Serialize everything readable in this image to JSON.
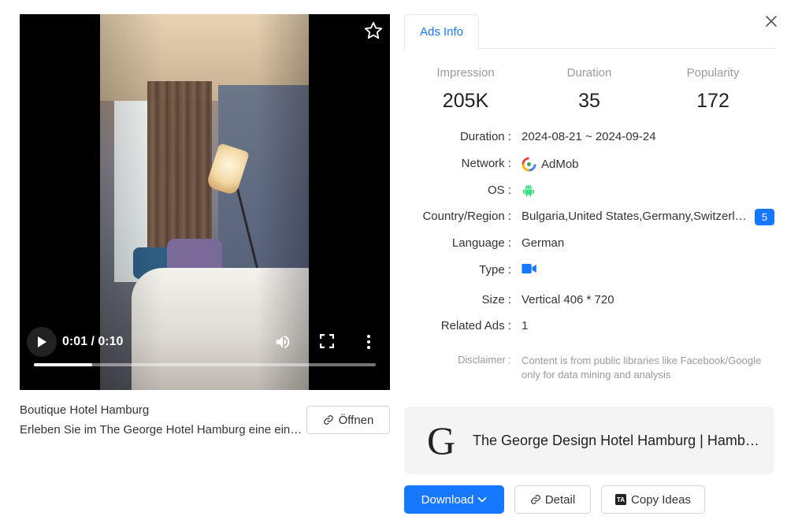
{
  "video": {
    "time": "0:01 / 0:10",
    "progress_fraction": 0.17
  },
  "ad": {
    "title": "Boutique Hotel Hamburg",
    "description": "Erleben Sie im The George Hotel Hamburg eine einzigartige Atmosphäre",
    "open_label": "Öffnen"
  },
  "tabs": [
    {
      "label": "Ads Info",
      "active": true
    }
  ],
  "stats": {
    "impression": {
      "label": "Impression",
      "value": "205K"
    },
    "duration": {
      "label": "Duration",
      "value": "35"
    },
    "popularity": {
      "label": "Popularity",
      "value": "172"
    }
  },
  "details": {
    "duration": {
      "label": "Duration :",
      "value": "2024-08-21 ~ 2024-09-24"
    },
    "network": {
      "label": "Network :",
      "value": "AdMob",
      "icon": "admob-icon"
    },
    "os": {
      "label": "OS :",
      "icon": "android-icon"
    },
    "country": {
      "label": "Country/Region :",
      "value": "Bulgaria,United States,Germany,Switzerland,Austria",
      "count": "5"
    },
    "language": {
      "label": "Language :",
      "value": "German"
    },
    "type": {
      "label": "Type :",
      "icon": "video-camera-icon"
    },
    "size": {
      "label": "Size :",
      "value": "Vertical 406 * 720"
    },
    "related": {
      "label": "Related Ads :",
      "value": "1"
    },
    "disclaimer": {
      "label": "Disclaimer :",
      "value": "Content is from public libraries like Facebook/Google only for data mining and analysis"
    }
  },
  "advertiser": {
    "logo_letter": "G",
    "name": "The George Design Hotel Hamburg | Hamburg"
  },
  "actions": {
    "download_label": "Download",
    "detail_label": "Detail",
    "copy_label": "Copy Ideas"
  },
  "colors": {
    "accent": "#1677ff",
    "android": "#3ddc84"
  }
}
